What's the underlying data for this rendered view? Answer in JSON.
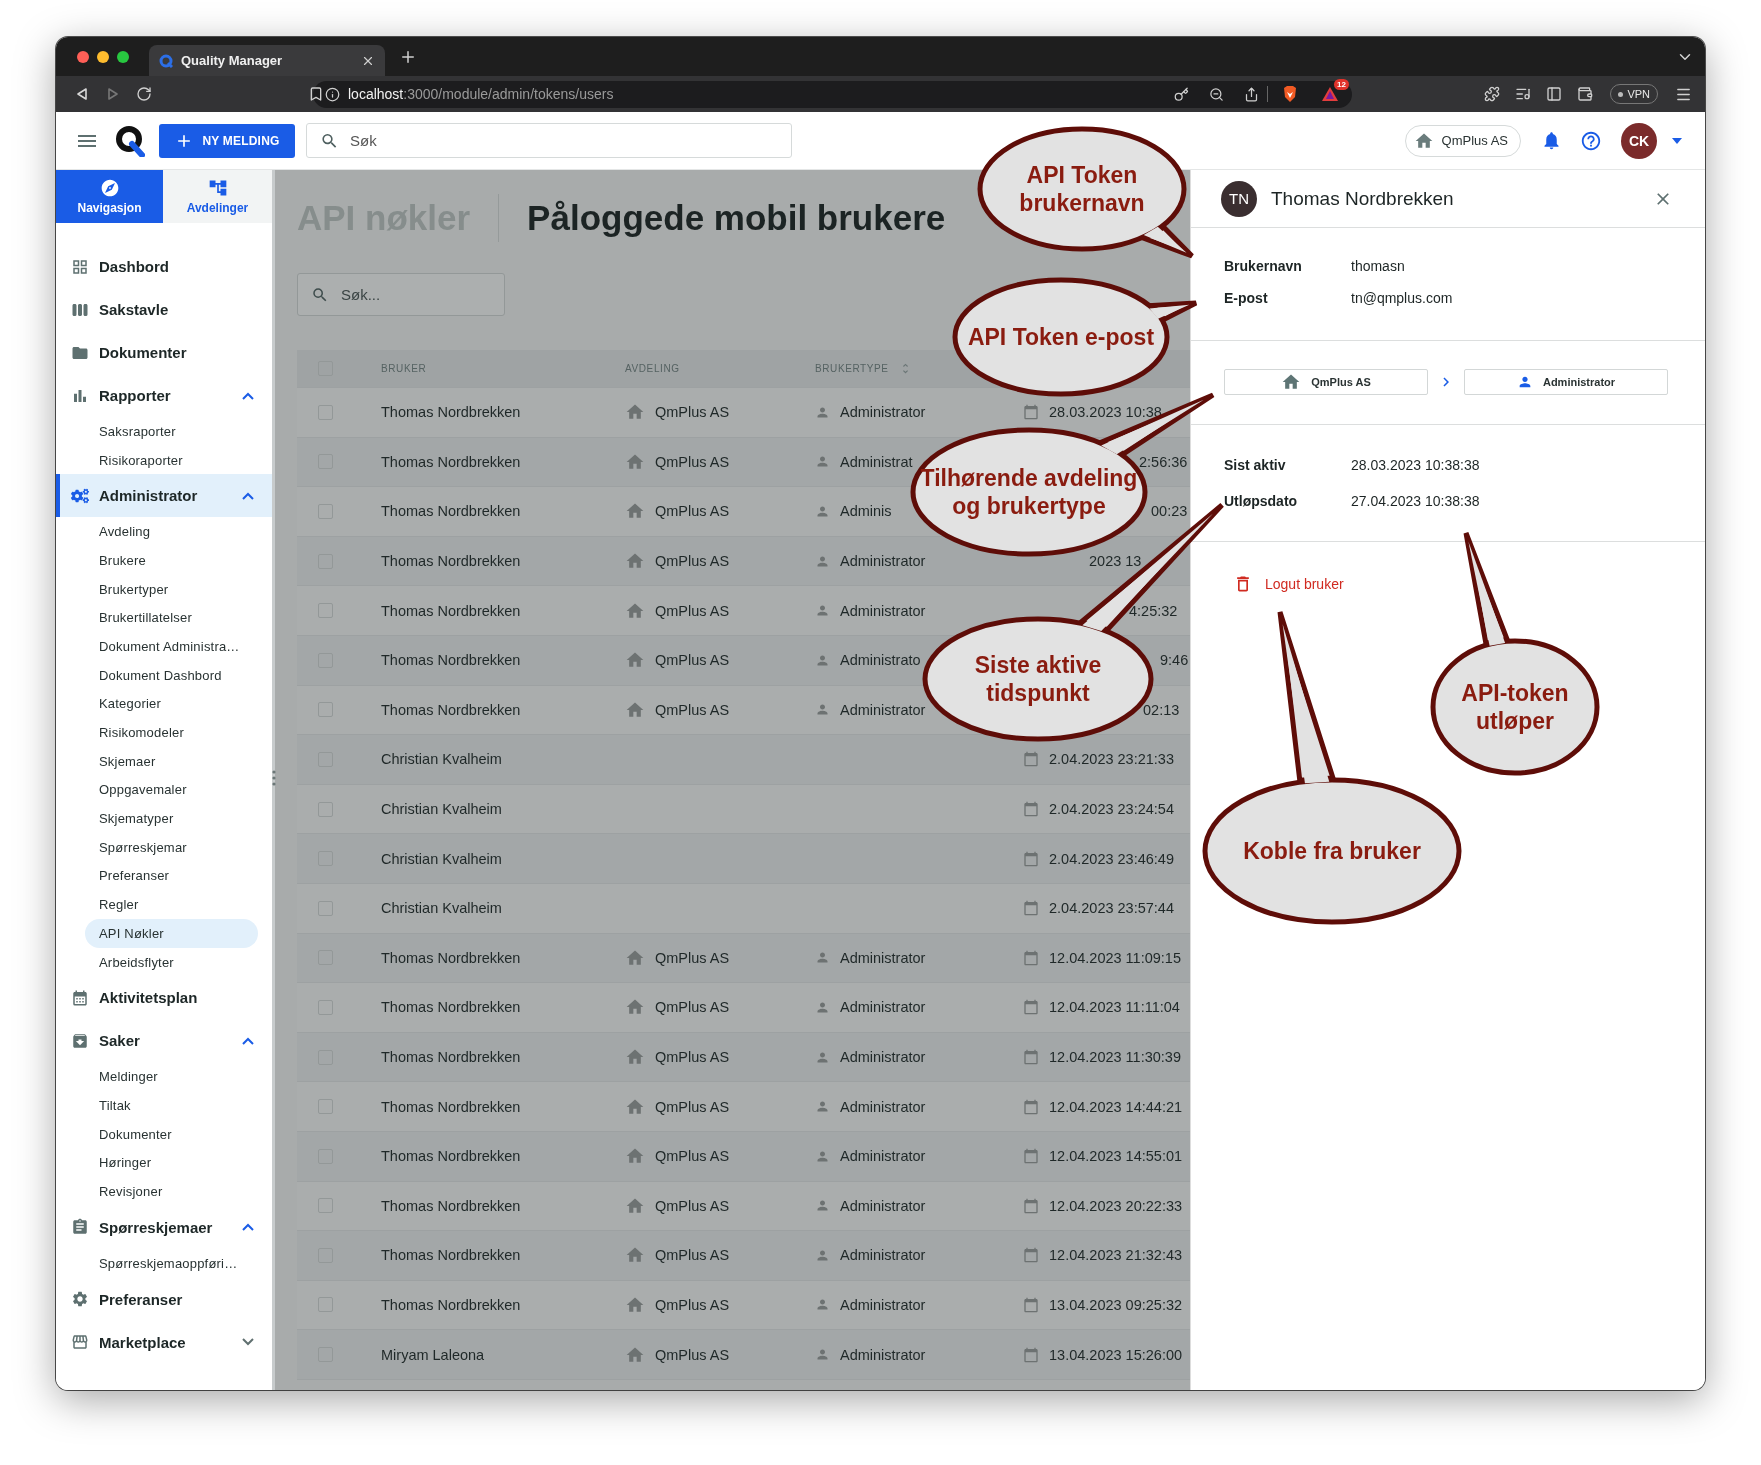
{
  "browser": {
    "tab_title": "Quality Manager",
    "url_host": "localhost",
    "url_path": ":3000/module/admin/tokens/users",
    "extension_badge": "12",
    "vpn_label": "VPN"
  },
  "header": {
    "new_button": "NY MELDING",
    "search_placeholder": "Søk",
    "company": "QmPlus AS",
    "avatar_initials": "CK"
  },
  "sidebar": {
    "tabs": [
      {
        "label": "Navigasjon",
        "selected": true
      },
      {
        "label": "Avdelinger",
        "selected": false
      }
    ],
    "items": [
      {
        "label": "Dashbord",
        "selected": false
      },
      {
        "label": "Sakstavle",
        "selected": false
      },
      {
        "label": "Dokumenter",
        "selected": false
      },
      {
        "label": "Rapporter",
        "selected": false,
        "expanded": true,
        "children": [
          {
            "label": "Saksraporter",
            "selected": false
          },
          {
            "label": "Risikoraporter",
            "selected": false
          }
        ]
      },
      {
        "label": "Administrator",
        "selected": true,
        "expanded": true,
        "children": [
          {
            "label": "Avdeling",
            "selected": false
          },
          {
            "label": "Brukere",
            "selected": false
          },
          {
            "label": "Brukertyper",
            "selected": false
          },
          {
            "label": "Brukertillatelser",
            "selected": false
          },
          {
            "label": "Dokument Administra…",
            "selected": false
          },
          {
            "label": "Dokument Dashbord",
            "selected": false
          },
          {
            "label": "Kategorier",
            "selected": false
          },
          {
            "label": "Risikomodeler",
            "selected": false
          },
          {
            "label": "Skjemaer",
            "selected": false
          },
          {
            "label": "Oppgavemaler",
            "selected": false
          },
          {
            "label": "Skjematyper",
            "selected": false
          },
          {
            "label": "Spørreskjemar",
            "selected": false
          },
          {
            "label": "Preferanser",
            "selected": false
          },
          {
            "label": "Regler",
            "selected": false
          },
          {
            "label": "API Nøkler",
            "selected": true
          },
          {
            "label": "Arbeidsflyter",
            "selected": false
          }
        ]
      },
      {
        "label": "Aktivitetsplan",
        "selected": false
      },
      {
        "label": "Saker",
        "selected": false,
        "expanded": true,
        "children": [
          {
            "label": "Meldinger",
            "selected": false
          },
          {
            "label": "Tiltak",
            "selected": false
          },
          {
            "label": "Dokumenter",
            "selected": false
          },
          {
            "label": "Høringer",
            "selected": false
          },
          {
            "label": "Revisjoner",
            "selected": false
          }
        ]
      },
      {
        "label": "Spørreskjemaer",
        "selected": false,
        "expanded": true,
        "children": [
          {
            "label": "Spørreskjemaoppføri…",
            "selected": false
          }
        ]
      },
      {
        "label": "Preferanser",
        "selected": false
      },
      {
        "label": "Marketplace",
        "selected": false,
        "expanded": false
      }
    ]
  },
  "main": {
    "section_title": "API nøkler",
    "title": "Påloggede mobil brukere",
    "search_placeholder": "Søk...",
    "table": {
      "columns": [
        "BRUKER",
        "AVDELING",
        "BRUKERTYPE"
      ],
      "all_checked": false,
      "rows": [
        {
          "checked": false,
          "user": "Thomas Nordbrekken",
          "department": "QmPlus AS",
          "user_type": "Administrator",
          "date": "28.03.2023 10:38",
          "date_partial": false
        },
        {
          "checked": false,
          "user": "Thomas Nordbrekken",
          "department": "QmPlus AS",
          "user_type": "Administrat",
          "date": "2:56:36",
          "date_partial": true
        },
        {
          "checked": false,
          "user": "Thomas Nordbrekken",
          "department": "QmPlus AS",
          "user_type": "Adminis",
          "date": "00:23",
          "date_partial": true
        },
        {
          "checked": false,
          "user": "Thomas Nordbrekken",
          "department": "QmPlus AS",
          "user_type": "Administrator",
          "date": "2023 13",
          "date_partial": true
        },
        {
          "checked": false,
          "user": "Thomas Nordbrekken",
          "department": "QmPlus AS",
          "user_type": "Administrator",
          "date": "4:25:32",
          "date_partial": true
        },
        {
          "checked": false,
          "user": "Thomas Nordbrekken",
          "department": "QmPlus AS",
          "user_type": "Administrato",
          "date": "9:46",
          "date_partial": true
        },
        {
          "checked": false,
          "user": "Thomas Nordbrekken",
          "department": "QmPlus AS",
          "user_type": "Administrator",
          "date": "02:13",
          "date_partial": true
        },
        {
          "checked": false,
          "user": "Christian Kvalheim",
          "date": "2.04.2023 23:21:33",
          "date_partial": false
        },
        {
          "checked": false,
          "user": "Christian Kvalheim",
          "date": "2.04.2023 23:24:54",
          "date_partial": false
        },
        {
          "checked": false,
          "user": "Christian Kvalheim",
          "date": "2.04.2023 23:46:49",
          "date_partial": false
        },
        {
          "checked": false,
          "user": "Christian Kvalheim",
          "date": "2.04.2023 23:57:44",
          "date_partial": false
        },
        {
          "checked": false,
          "user": "Thomas Nordbrekken",
          "department": "QmPlus AS",
          "user_type": "Administrator",
          "date": "12.04.2023 11:09:15",
          "date_partial": false
        },
        {
          "checked": false,
          "user": "Thomas Nordbrekken",
          "department": "QmPlus AS",
          "user_type": "Administrator",
          "date": "12.04.2023 11:11:04",
          "date_partial": false
        },
        {
          "checked": false,
          "user": "Thomas Nordbrekken",
          "department": "QmPlus AS",
          "user_type": "Administrator",
          "date": "12.04.2023 11:30:39",
          "date_partial": false
        },
        {
          "checked": false,
          "user": "Thomas Nordbrekken",
          "department": "QmPlus AS",
          "user_type": "Administrator",
          "date": "12.04.2023 14:44:21",
          "date_partial": false
        },
        {
          "checked": false,
          "user": "Thomas Nordbrekken",
          "department": "QmPlus AS",
          "user_type": "Administrator",
          "date": "12.04.2023 14:55:01",
          "date_partial": false
        },
        {
          "checked": false,
          "user": "Thomas Nordbrekken",
          "department": "QmPlus AS",
          "user_type": "Administrator",
          "date": "12.04.2023 20:22:33",
          "date_partial": false
        },
        {
          "checked": false,
          "user": "Thomas Nordbrekken",
          "department": "QmPlus AS",
          "user_type": "Administrator",
          "date": "12.04.2023 21:32:43",
          "date_partial": false
        },
        {
          "checked": false,
          "user": "Thomas Nordbrekken",
          "department": "QmPlus AS",
          "user_type": "Administrator",
          "date": "13.04.2023 09:25:32",
          "date_partial": false
        },
        {
          "checked": false,
          "user": "Miryam Laleona",
          "department": "QmPlus AS",
          "user_type": "Administrator",
          "date": "13.04.2023 15:26:00",
          "date_partial": false
        }
      ]
    }
  },
  "detail": {
    "avatar_initials": "TN",
    "name": "Thomas Nordbrekken",
    "fields": [
      {
        "label": "Brukernavn",
        "value": "thomasn"
      },
      {
        "label": "E-post",
        "value": "tn@qmplus.com"
      }
    ],
    "department": "QmPlus AS",
    "user_type": "Administrator",
    "dates": [
      {
        "label": "Sist aktiv",
        "value": "28.03.2023 10:38:38"
      },
      {
        "label": "Utløpsdato",
        "value": "27.04.2023 10:38:38"
      }
    ],
    "logout_label": "Logut bruker"
  },
  "annotations": [
    {
      "text": "API Token\nbrukernavn"
    },
    {
      "text": "API Token e-post"
    },
    {
      "text": "Tilhørende avdeling\nog brukertype"
    },
    {
      "text": "Siste aktive\ntidspunkt"
    },
    {
      "text": "API-token\nutløper"
    },
    {
      "text": "Koble fra bruker"
    }
  ]
}
